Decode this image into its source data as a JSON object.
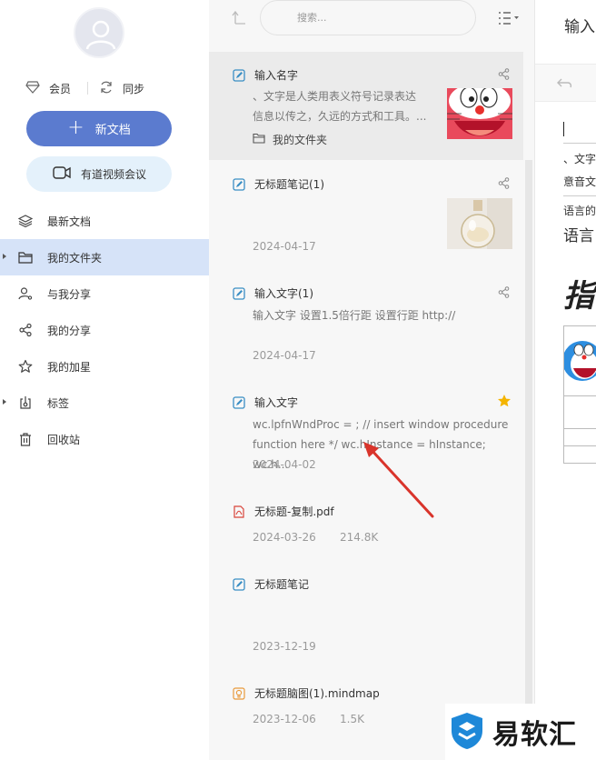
{
  "sidebar": {
    "member_label": "会员",
    "sync_label": "同步",
    "new_doc_label": "新文档",
    "video_meeting_label": "有道视频会议",
    "nav": [
      {
        "label": "最新文档",
        "icon": "layers-icon"
      },
      {
        "label": "我的文件夹",
        "icon": "folder-icon"
      },
      {
        "label": "与我分享",
        "icon": "shared-user-icon"
      },
      {
        "label": "我的分享",
        "icon": "share-icon"
      },
      {
        "label": "我的加星",
        "icon": "star-outline-icon"
      },
      {
        "label": "标签",
        "icon": "tag-icon"
      },
      {
        "label": "回收站",
        "icon": "trash-icon"
      }
    ]
  },
  "list": {
    "search_placeholder": "搜索...",
    "notes": [
      {
        "title": "输入名字",
        "snippet_1": "、文字是人类用表义符号记录表达",
        "snippet_2": "信息以传之，久远的方式和工具。...",
        "folder": "我的文件夹"
      },
      {
        "title": "无标题笔记(1)",
        "date": "2024-04-17"
      },
      {
        "title": "输入文字(1)",
        "snippet_1": "输入文字 设置1.5倍行距 设置行距 http://",
        "date": "2024-04-17"
      },
      {
        "title": "输入文字",
        "snippet_1": "wc.lpfnWndProc = ; // insert window procedure",
        "snippet_2": "function here */ wc.hInstance = hInstance; wc.h...",
        "date": "2024-04-02"
      },
      {
        "title": "无标题-复制.pdf",
        "date": "2024-03-26",
        "size": "214.8K"
      },
      {
        "title": "无标题笔记",
        "date": "2023-12-19"
      },
      {
        "title": "无标题脑图(1).mindmap",
        "date": "2023-12-06",
        "size": "1.5K"
      }
    ]
  },
  "editor": {
    "title": "输入",
    "line_1": "、文字",
    "line_2": "意音文",
    "line_3": "语言的",
    "line_4": "语言",
    "heading": "指"
  },
  "watermark": {
    "text": "易软汇"
  },
  "colors": {
    "accent": "#5b7bcf",
    "active_nav": "#d6e3f8",
    "video_btn": "#e4f1fb",
    "note_icon": "#3a8ec4",
    "star": "#f4b400",
    "arrow": "#d9342b"
  }
}
